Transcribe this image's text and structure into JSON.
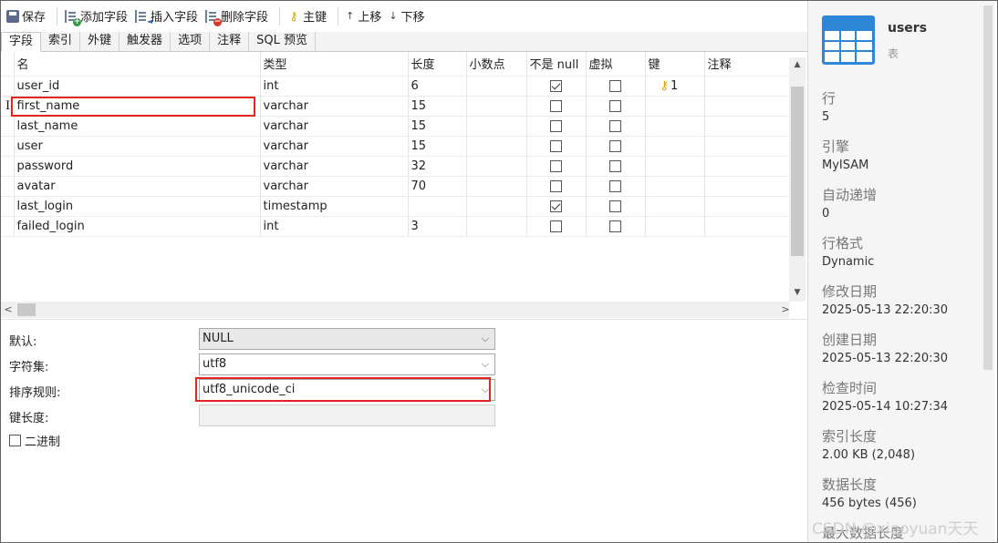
{
  "toolbar": {
    "save": "保存",
    "add_field": "添加字段",
    "insert_field": "插入字段",
    "delete_field": "删除字段",
    "primary_key": "主键",
    "move_up": "上移",
    "move_down": "下移"
  },
  "tabs": [
    "字段",
    "索引",
    "外键",
    "触发器",
    "选项",
    "注释",
    "SQL 预览"
  ],
  "active_tab": "字段",
  "grid": {
    "headers": [
      "名",
      "类型",
      "长度",
      "小数点",
      "不是 null",
      "虚拟",
      "键",
      "注释"
    ],
    "rows": [
      {
        "name": "user_id",
        "type": "int",
        "length": "6",
        "decimals": "",
        "not_null": true,
        "virtual": false,
        "key": "1",
        "comment": ""
      },
      {
        "name": "first_name",
        "type": "varchar",
        "length": "15",
        "decimals": "",
        "not_null": false,
        "virtual": false,
        "key": "",
        "comment": ""
      },
      {
        "name": "last_name",
        "type": "varchar",
        "length": "15",
        "decimals": "",
        "not_null": false,
        "virtual": false,
        "key": "",
        "comment": ""
      },
      {
        "name": "user",
        "type": "varchar",
        "length": "15",
        "decimals": "",
        "not_null": false,
        "virtual": false,
        "key": "",
        "comment": ""
      },
      {
        "name": "password",
        "type": "varchar",
        "length": "32",
        "decimals": "",
        "not_null": false,
        "virtual": false,
        "key": "",
        "comment": ""
      },
      {
        "name": "avatar",
        "type": "varchar",
        "length": "70",
        "decimals": "",
        "not_null": false,
        "virtual": false,
        "key": "",
        "comment": ""
      },
      {
        "name": "last_login",
        "type": "timestamp",
        "length": "",
        "decimals": "",
        "not_null": true,
        "virtual": false,
        "key": "",
        "comment": ""
      },
      {
        "name": "failed_login",
        "type": "int",
        "length": "3",
        "decimals": "",
        "not_null": false,
        "virtual": false,
        "key": "",
        "comment": ""
      }
    ]
  },
  "properties": {
    "default_label": "默认:",
    "default_value": "NULL",
    "charset_label": "字符集:",
    "charset_value": "utf8",
    "collation_label": "排序规则:",
    "collation_value": "utf8_unicode_ci",
    "key_length_label": "键长度:",
    "key_length_value": "",
    "binary_label": "二进制",
    "binary_checked": false
  },
  "info": {
    "object_name": "users",
    "object_type": "表",
    "items": [
      {
        "label": "行",
        "value": "5"
      },
      {
        "label": "引擎",
        "value": "MyISAM"
      },
      {
        "label": "自动递增",
        "value": "0"
      },
      {
        "label": "行格式",
        "value": "Dynamic"
      },
      {
        "label": "修改日期",
        "value": "2025-05-13 22:20:30"
      },
      {
        "label": "创建日期",
        "value": "2025-05-13 22:20:30"
      },
      {
        "label": "检查时间",
        "value": "2025-05-14 10:27:34"
      },
      {
        "label": "索引长度",
        "value": "2.00 KB (2,048)"
      },
      {
        "label": "数据长度",
        "value": "456 bytes (456)"
      },
      {
        "label": "最大数据长度",
        "value": ""
      }
    ]
  },
  "watermark": "CSDN @xiaoyuan天天",
  "colors": {
    "highlight": "#e0261e",
    "accent": "#2e86d6",
    "key_icon": "#e0a100"
  }
}
